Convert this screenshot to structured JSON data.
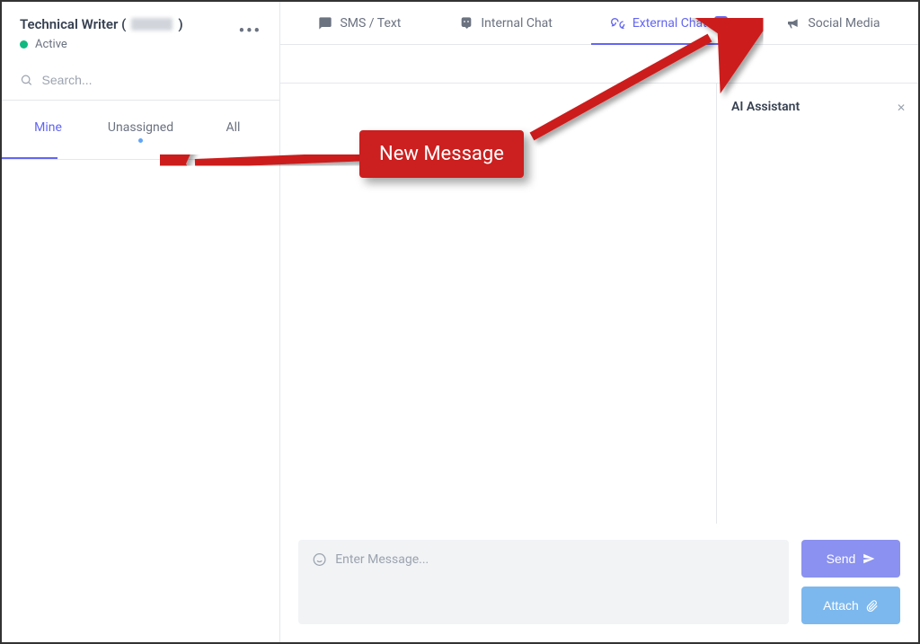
{
  "sidebar": {
    "user_title_prefix": "Technical Writer (",
    "user_title_suffix": ")",
    "status_label": "Active",
    "search_placeholder": "Search...",
    "filters": {
      "mine": "Mine",
      "unassigned": "Unassigned",
      "all": "All"
    }
  },
  "top_tabs": {
    "sms": "SMS / Text",
    "internal": "Internal Chat",
    "external": "External Chat",
    "external_badge": "1",
    "social": "Social Media"
  },
  "ai_panel": {
    "title": "AI Assistant"
  },
  "composer": {
    "placeholder": "Enter Message...",
    "send": "Send",
    "attach": "Attach"
  },
  "annotation": {
    "label": "New Message"
  }
}
